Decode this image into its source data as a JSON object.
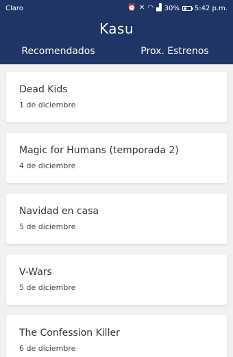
{
  "status_bar": {
    "carrier": "Claro",
    "battery": "30%",
    "time": "5:42 p.m."
  },
  "app": {
    "title": "Kasu"
  },
  "tabs": [
    {
      "label": "Recomendados"
    },
    {
      "label": "Prox. Estrenos"
    }
  ],
  "releases": [
    {
      "title": "Dead Kids",
      "date": "1 de diciembre"
    },
    {
      "title": "Magic for Humans (temporada 2)",
      "date": "4 de diciembre"
    },
    {
      "title": "Navidad en casa",
      "date": "5 de diciembre"
    },
    {
      "title": "V-Wars",
      "date": "5 de diciembre"
    },
    {
      "title": "The Confession Killer",
      "date": "6 de diciembre"
    }
  ],
  "colors": {
    "primary": "#1f3566",
    "background": "#f1f1f1",
    "card": "#ffffff"
  }
}
